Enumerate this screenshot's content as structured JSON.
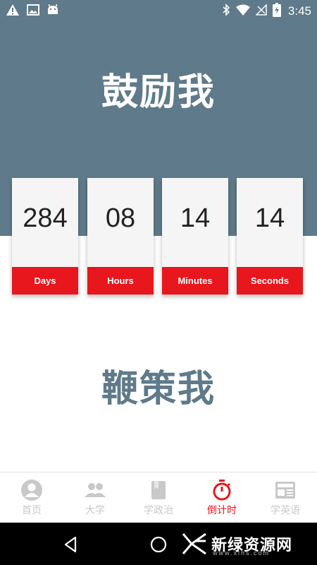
{
  "status_bar": {
    "time": "3:45",
    "icons_left": [
      "warning-icon",
      "image-icon",
      "android-icon"
    ],
    "icons_right": [
      "bluetooth-icon",
      "wifi-icon",
      "signal-off-icon",
      "battery-charging-icon"
    ]
  },
  "hero": {
    "title": "鼓励我"
  },
  "countdown": [
    {
      "value": "284",
      "label": "Days"
    },
    {
      "value": "08",
      "label": "Hours"
    },
    {
      "value": "14",
      "label": "Minutes"
    },
    {
      "value": "14",
      "label": "Seconds"
    }
  ],
  "subtitle": "鞭策我",
  "tabs": [
    {
      "label": "首页",
      "icon": "person-icon",
      "active": false
    },
    {
      "label": "大学",
      "icon": "people-icon",
      "active": false
    },
    {
      "label": "学政治",
      "icon": "book-icon",
      "active": false
    },
    {
      "label": "倒计时",
      "icon": "stopwatch-icon",
      "active": true
    },
    {
      "label": "学英语",
      "icon": "newspaper-icon",
      "active": false
    }
  ],
  "watermark": {
    "text": "新绿资源网",
    "sub": "www.xlhs.com"
  },
  "colors": {
    "primary": "#5f7a8a",
    "accent": "#e8161d",
    "inactive": "#c9c9c9"
  }
}
